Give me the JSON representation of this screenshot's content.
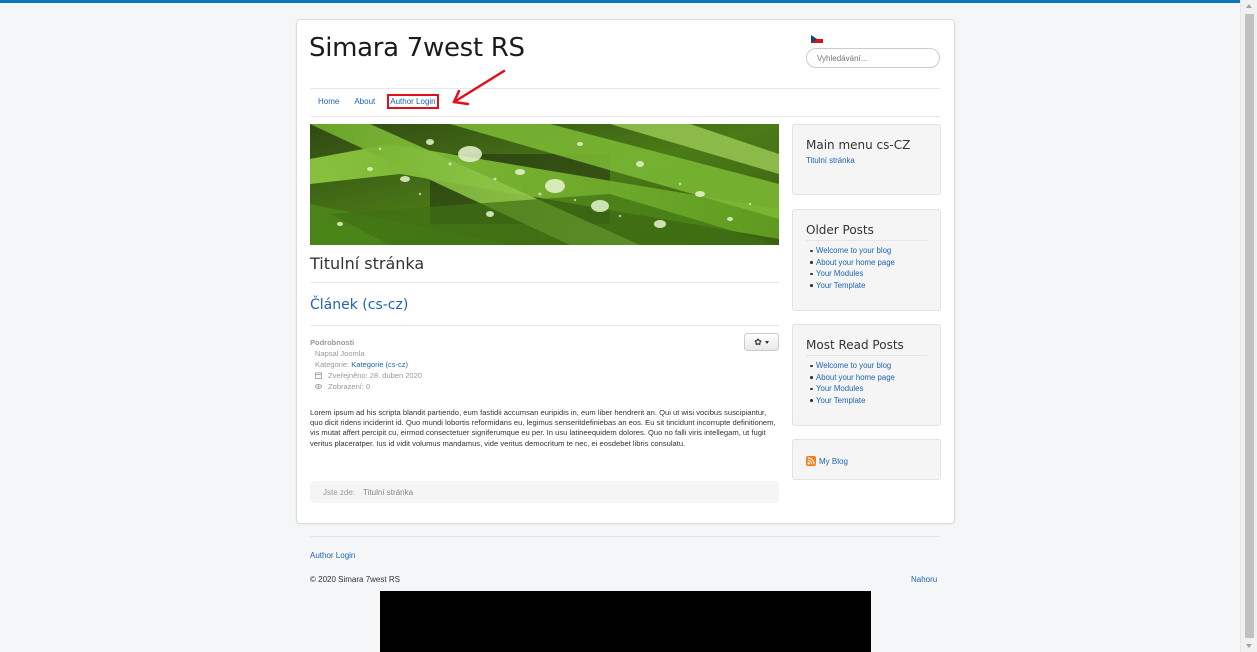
{
  "site": {
    "brand": "Simara 7west RS",
    "search_placeholder": "Vyhledávání..."
  },
  "nav": {
    "items": [
      "Home",
      "About",
      "Author Login"
    ]
  },
  "main": {
    "page_heading": "Titulní stránka",
    "article_title": "Článek (cs-cz)",
    "details": {
      "label": "Podrobnosti",
      "author": "Napsal Joomla",
      "category_label": "Kategorie:",
      "category_link": "Kategorie (cs-cz)",
      "published": "Zveřejněno: 28. duben 2020",
      "hits": "Zobrazení: 0"
    },
    "body_text": "Lorem ipsum ad his scripta blandit partiendo, eum fastidii accumsan euripidis in, eum liber hendrerit an. Qui ut wisi vocibus suscipiantur, quo dicit ridens inciderint id. Quo mundi lobortis reformidans eu, legimus senseritdefiniebas an eos. Eu sit tincidunt incorrupte definitionem, vis mutat affert percipit cu, eirmod consectetuer signiferumque eu per. In usu latineequidem dolores. Quo no falli viris intellegam, ut fugit veritus placeratper. Ius id vidit volumus mandamus, vide veritus democritum te nec, ei eosdebet libris consulatu.",
    "breadcrumb": {
      "prefix": "Jste zde:",
      "current": "Titulní stránka"
    }
  },
  "sidebar": {
    "main_menu": {
      "title": "Main menu cs-CZ",
      "link": "Titulní stránka"
    },
    "older_posts": {
      "title": "Older Posts",
      "items": [
        "Welcome to your blog",
        "About your home page",
        "Your Modules",
        "Your Template"
      ]
    },
    "most_read": {
      "title": "Most Read Posts",
      "items": [
        "Welcome to your blog",
        "About your home page",
        "Your Modules",
        "Your Template"
      ]
    },
    "rss": {
      "label": "My Blog"
    }
  },
  "footer": {
    "link": "Author Login",
    "copyright": "© 2020 Simara 7west RS",
    "back_to_top": "Nahoru"
  },
  "colors": {
    "link": "#1e64b3",
    "highlight_red": "#e0101b",
    "top_bar": "#0f75bc"
  }
}
